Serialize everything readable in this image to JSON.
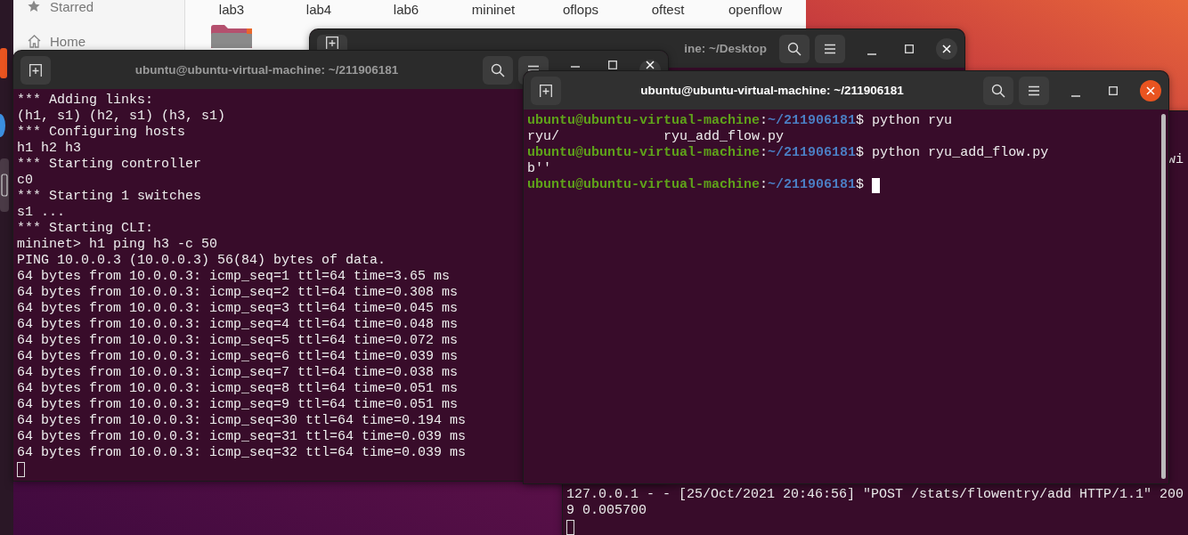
{
  "file_manager": {
    "sidebar": [
      {
        "label": "Starred",
        "kind": "star"
      },
      {
        "label": "Home",
        "kind": "home"
      }
    ],
    "folders": [
      {
        "name": "lab3",
        "icon_visible": true
      },
      {
        "name": "lab4",
        "icon_visible": false
      },
      {
        "name": "lab6",
        "icon_visible": false
      },
      {
        "name": "mininet",
        "icon_visible": false
      },
      {
        "name": "oflops",
        "icon_visible": false
      },
      {
        "name": "oftest",
        "icon_visible": false
      },
      {
        "name": "openflow",
        "icon_visible": false
      }
    ]
  },
  "terminals": [
    {
      "focused": false,
      "top_lines": [
        {
          "kind": "tail",
          "text": "wi",
          "cursor": false
        }
      ],
      "lines": [
        {
          "kind": "output",
          "text": "127.0.0.1 - - [25/Oct/2021 20:46:56] \"POST /stats/flowentry/add HTTP/1.1\" 200",
          "cursor": false
        },
        {
          "kind": "output",
          "text": "9 0.005700",
          "cursor": false
        },
        {
          "kind": "blank",
          "cursor": true
        }
      ]
    },
    {
      "title": "ine: ~/Desktop",
      "focused": false
    },
    {
      "title": "ubuntu@ubuntu-virtual-machine: ~/211906181",
      "focused": false,
      "lines": [
        {
          "kind": "output",
          "text": "*** Adding links:",
          "cursor": false
        },
        {
          "kind": "output",
          "text": "(h1, s1) (h2, s1) (h3, s1)",
          "cursor": false
        },
        {
          "kind": "output",
          "text": "*** Configuring hosts",
          "cursor": false
        },
        {
          "kind": "output",
          "text": "h1 h2 h3",
          "cursor": false
        },
        {
          "kind": "output",
          "text": "*** Starting controller",
          "cursor": false
        },
        {
          "kind": "output",
          "text": "c0",
          "cursor": false
        },
        {
          "kind": "output",
          "text": "*** Starting 1 switches",
          "cursor": false
        },
        {
          "kind": "output",
          "text": "s1 ...",
          "cursor": false
        },
        {
          "kind": "output",
          "text": "*** Starting CLI:",
          "cursor": false
        },
        {
          "kind": "output",
          "text": "mininet> h1 ping h3 -c 50",
          "cursor": false
        },
        {
          "kind": "output",
          "text": "PING 10.0.0.3 (10.0.0.3) 56(84) bytes of data.",
          "cursor": false
        },
        {
          "kind": "output",
          "text": "64 bytes from 10.0.0.3: icmp_seq=1 ttl=64 time=3.65 ms",
          "cursor": false
        },
        {
          "kind": "output",
          "text": "64 bytes from 10.0.0.3: icmp_seq=2 ttl=64 time=0.308 ms",
          "cursor": false
        },
        {
          "kind": "output",
          "text": "64 bytes from 10.0.0.3: icmp_seq=3 ttl=64 time=0.045 ms",
          "cursor": false
        },
        {
          "kind": "output",
          "text": "64 bytes from 10.0.0.3: icmp_seq=4 ttl=64 time=0.048 ms",
          "cursor": false
        },
        {
          "kind": "output",
          "text": "64 bytes from 10.0.0.3: icmp_seq=5 ttl=64 time=0.072 ms",
          "cursor": false
        },
        {
          "kind": "output",
          "text": "64 bytes from 10.0.0.3: icmp_seq=6 ttl=64 time=0.039 ms",
          "cursor": false
        },
        {
          "kind": "output",
          "text": "64 bytes from 10.0.0.3: icmp_seq=7 ttl=64 time=0.038 ms",
          "cursor": false
        },
        {
          "kind": "output",
          "text": "64 bytes from 10.0.0.3: icmp_seq=8 ttl=64 time=0.051 ms",
          "cursor": false
        },
        {
          "kind": "output",
          "text": "64 bytes from 10.0.0.3: icmp_seq=9 ttl=64 time=0.051 ms",
          "cursor": false
        },
        {
          "kind": "output",
          "text": "64 bytes from 10.0.0.3: icmp_seq=30 ttl=64 time=0.194 ms",
          "cursor": false
        },
        {
          "kind": "output",
          "text": "64 bytes from 10.0.0.3: icmp_seq=31 ttl=64 time=0.039 ms",
          "cursor": false
        },
        {
          "kind": "output",
          "text": "64 bytes from 10.0.0.3: icmp_seq=32 ttl=64 time=0.039 ms",
          "cursor": false
        },
        {
          "kind": "blank",
          "cursor": true
        }
      ]
    },
    {
      "title": "ubuntu@ubuntu-virtual-machine: ~/211906181",
      "focused": true,
      "lines": [
        {
          "kind": "prompt",
          "user": "ubuntu@ubuntu-virtual-machine",
          "separator": ":",
          "path": "~/211906181",
          "symbol": "$",
          "command": " python ryu",
          "cursor": false
        },
        {
          "kind": "output",
          "text": "ryu/             ryu_add_flow.py",
          "cursor": false
        },
        {
          "kind": "prompt",
          "user": "ubuntu@ubuntu-virtual-machine",
          "separator": ":",
          "path": "~/211906181",
          "symbol": "$",
          "command": " python ryu_add_flow.py",
          "cursor": false
        },
        {
          "kind": "output",
          "text": "b''",
          "cursor": false
        },
        {
          "kind": "prompt",
          "user": "ubuntu@ubuntu-virtual-machine",
          "separator": ":",
          "path": "~/211906181",
          "symbol": "$ ",
          "cursor": true
        }
      ]
    }
  ]
}
